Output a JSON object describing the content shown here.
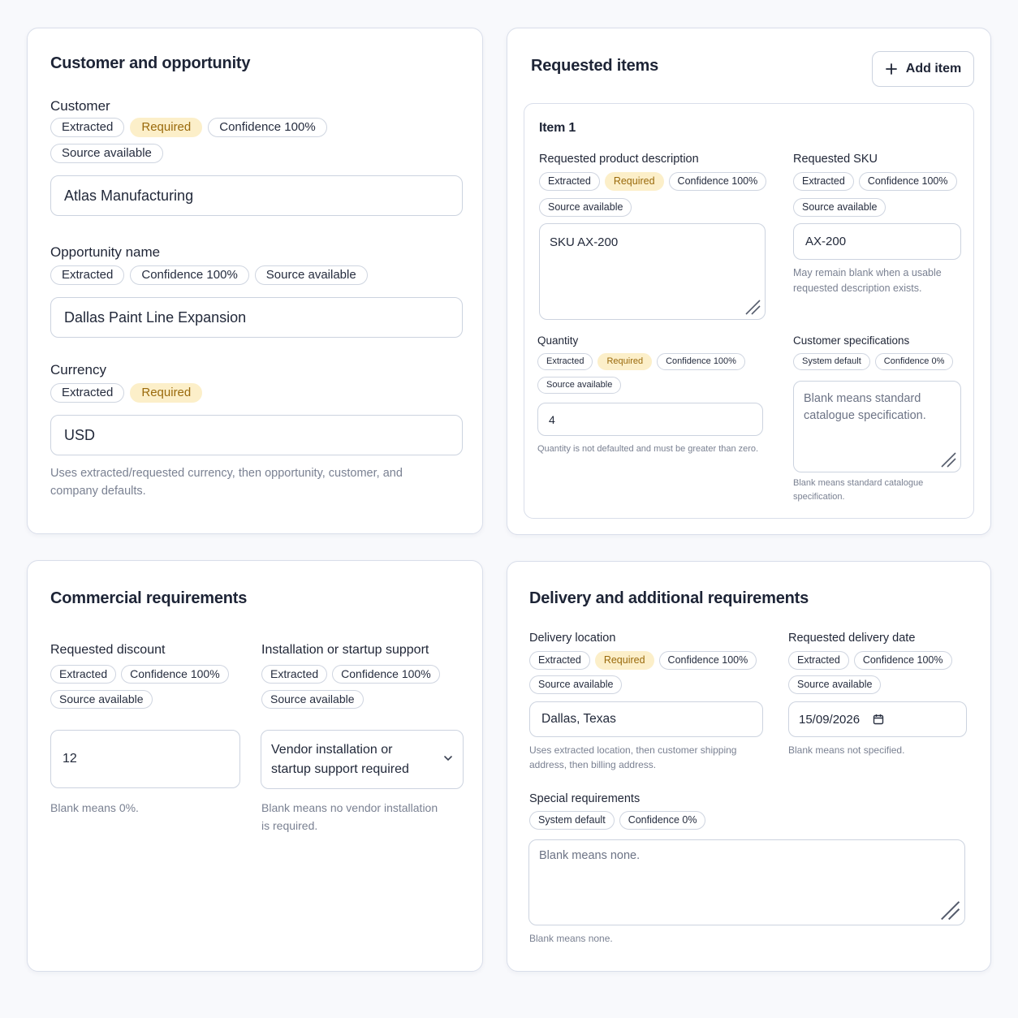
{
  "customer_card": {
    "title": "Customer and opportunity",
    "customer": {
      "label": "Customer",
      "badges": [
        "Extracted",
        "Required",
        "Confidence 100%",
        "Source available"
      ],
      "value": "Atlas Manufacturing"
    },
    "opportunity": {
      "label": "Opportunity name",
      "badges": [
        "Extracted",
        "Confidence 100%",
        "Source available"
      ],
      "value": "Dallas Paint Line Expansion"
    },
    "currency": {
      "label": "Currency",
      "badges": [
        "Extracted",
        "Required"
      ],
      "value": "USD",
      "helper": "Uses extracted/requested currency, then opportunity, customer, and company defaults."
    }
  },
  "items_card": {
    "title": "Requested items",
    "add_button": "Add item",
    "item": {
      "title": "Item 1",
      "description": {
        "label": "Requested product description",
        "badges": [
          "Extracted",
          "Required",
          "Confidence 100%",
          "Source available"
        ],
        "value": "SKU AX-200"
      },
      "sku": {
        "label": "Requested SKU",
        "badges": [
          "Extracted",
          "Confidence 100%",
          "Source available"
        ],
        "value": "AX-200",
        "helper": "May remain blank when a usable requested description exists."
      },
      "quantity": {
        "label": "Quantity",
        "badges": [
          "Extracted",
          "Required",
          "Confidence 100%",
          "Source available"
        ],
        "value": "4",
        "helper": "Quantity is not defaulted and must be greater than zero."
      },
      "specs": {
        "label": "Customer specifications",
        "badges": [
          "System default",
          "Confidence 0%"
        ],
        "placeholder": "Blank means standard catalogue specification.",
        "helper": "Blank means standard catalogue specification."
      }
    }
  },
  "commercial_card": {
    "title": "Commercial requirements",
    "discount": {
      "label": "Requested discount",
      "badges": [
        "Extracted",
        "Confidence 100%",
        "Source available"
      ],
      "value": "12",
      "helper": "Blank means 0%."
    },
    "installation": {
      "label": "Installation or startup support",
      "badges": [
        "Extracted",
        "Confidence 100%",
        "Source available"
      ],
      "value": "Vendor installation or startup support required",
      "helper": "Blank means no vendor installation is required."
    }
  },
  "delivery_card": {
    "title": "Delivery and additional requirements",
    "location": {
      "label": "Delivery location",
      "badges": [
        "Extracted",
        "Required",
        "Confidence 100%",
        "Source available"
      ],
      "value": "Dallas, Texas",
      "helper": "Uses extracted location, then customer shipping address, then billing address."
    },
    "date": {
      "label": "Requested delivery date",
      "badges": [
        "Extracted",
        "Confidence 100%",
        "Source available"
      ],
      "value": "15/09/2026",
      "helper": "Blank means not specified."
    },
    "special": {
      "label": "Special requirements",
      "badges": [
        "System default",
        "Confidence 0%"
      ],
      "placeholder": "Blank means none.",
      "helper": "Blank means none."
    }
  },
  "colors": {
    "required_bg": "#fcefc9",
    "required_text": "#9a6a0c",
    "border": "#ccd3df"
  },
  "icons": [
    "plus-icon",
    "resize-handle-icon",
    "chevron-down-icon",
    "calendar-icon"
  ]
}
